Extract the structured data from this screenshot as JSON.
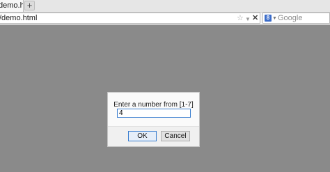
{
  "browser": {
    "tab": {
      "label": "demo.html"
    },
    "new_tab_label": "+",
    "address_bar": {
      "url": "/demo.html"
    },
    "search": {
      "placeholder": "Google",
      "engine_letter": "8"
    },
    "icons": {
      "bookmark": "star-icon",
      "history": "dropdown-icon",
      "stop": "close-icon"
    }
  },
  "dialog": {
    "prompt": "Enter a number from [1-7]",
    "input_value": "4",
    "ok_label": "OK",
    "cancel_label": "Cancel"
  },
  "colors": {
    "overlay": "#8a8a8a",
    "accent": "#3c7fd0"
  }
}
